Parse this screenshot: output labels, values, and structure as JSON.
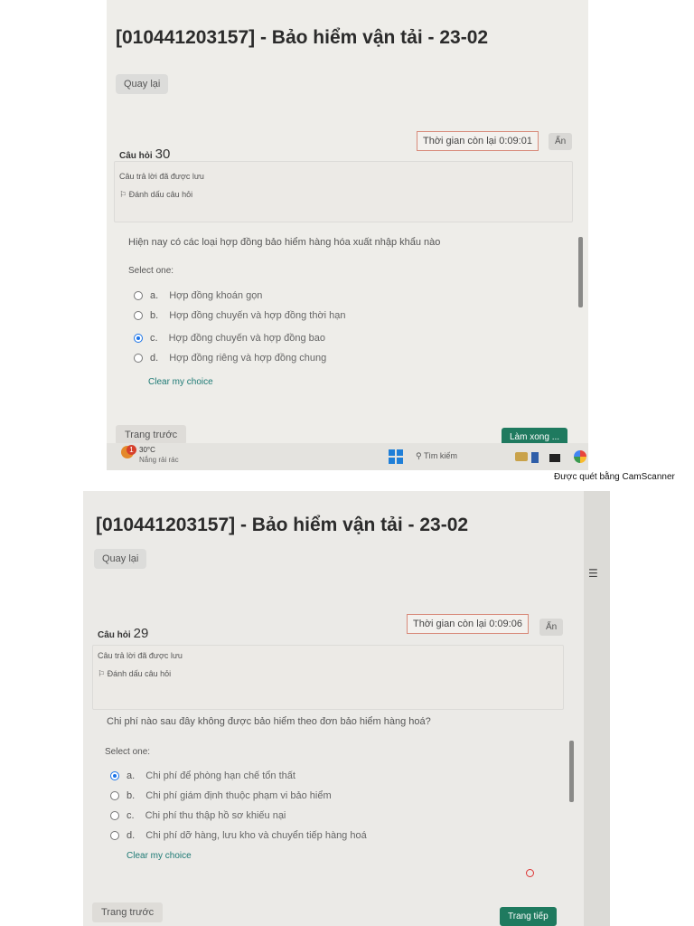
{
  "app": {
    "title": "[010441203157] - Bảo hiểm vận tải - 23-02"
  },
  "scanner_note": "Được quét bằng CamScanner",
  "top": {
    "title": "[010441203157] - Bảo hiểm vận tải - 23-02",
    "back_label": "Quay lại",
    "timer": "Thời gian còn lại 0:09:01",
    "hide_label": "Ẩn",
    "question_label": "Câu hỏi",
    "question_number": "30",
    "saved_text": "Câu trả lời đã được lưu",
    "flag_text": "Đánh dấu câu hỏi",
    "question_text": "Hiện nay có các loại hợp đồng bảo hiểm hàng hóa xuất nhập khẩu nào",
    "select_one": "Select one:",
    "options": [
      {
        "letter": "a.",
        "text": "Hợp đồng khoán gọn",
        "selected": false
      },
      {
        "letter": "b.",
        "text": "Hợp đồng chuyến và hợp đồng thời hạn",
        "selected": false
      },
      {
        "letter": "c.",
        "text": "Hợp đồng chuyến và hợp đồng bao",
        "selected": true
      },
      {
        "letter": "d.",
        "text": "Hợp đồng riêng và hợp đồng chung",
        "selected": false
      }
    ],
    "clear_choice": "Clear my choice",
    "prev_label": "Trang trước",
    "finish_label": "Làm xong ...",
    "taskbar": {
      "notification_count": "1",
      "temperature": "30°C",
      "weather": "Nắng rải rác",
      "search_placeholder": "Tìm kiếm"
    }
  },
  "bottom": {
    "title": "[010441203157] - Bảo hiểm vận tải - 23-02",
    "back_label": "Quay lại",
    "menu_icon": "list-icon",
    "timer": "Thời gian còn lại 0:09:06",
    "hide_label": "Ẩn",
    "question_label": "Câu hỏi",
    "question_number": "29",
    "saved_text": "Câu trả lời đã được lưu",
    "flag_text": "Đánh dấu câu hỏi",
    "question_text": "Chi phí nào sau đây không được bảo hiểm theo đơn bảo hiểm hàng hoá?",
    "select_one": "Select one:",
    "options": [
      {
        "letter": "a.",
        "text": "Chi phí để phòng hạn chế tổn thất",
        "selected": true
      },
      {
        "letter": "b.",
        "text": "Chi phí giám định thuộc phạm vi bảo hiểm",
        "selected": false
      },
      {
        "letter": "c.",
        "text": "Chi phí thu thập hồ sơ khiếu nại",
        "selected": false
      },
      {
        "letter": "d.",
        "text": "Chi phí dỡ hàng, lưu kho và chuyển tiếp hàng hoá",
        "selected": false
      }
    ],
    "clear_choice": "Clear my choice",
    "prev_label": "Trang trước",
    "next_label": "Trang tiếp"
  },
  "colors": {
    "accent_blue": "#1a73e8",
    "button_green": "#1f7a5f",
    "link_teal": "#1e7a75",
    "timer_border": "#d88b7b"
  }
}
